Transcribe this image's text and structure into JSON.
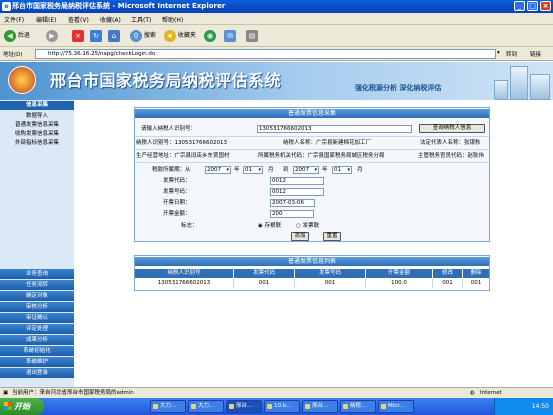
{
  "window": {
    "title": "邢台市国家税务局纳税评估系统 - Microsoft Internet Explorer",
    "min": "_",
    "max": "□",
    "close": "×"
  },
  "menu": [
    "文件(F)",
    "编辑(E)",
    "查看(V)",
    "收藏(A)",
    "工具(T)",
    "帮助(H)"
  ],
  "toolbar": {
    "back": "后退",
    "search": "搜索",
    "favorites": "收藏夹"
  },
  "address": {
    "label": "地址(D)",
    "url": "http://75.36.16.25/napg/checkLogin.do",
    "go": "转到",
    "links": "链接"
  },
  "banner": {
    "title": "邢台市国家税务局纳税评估系统",
    "slogan": "强化税源分析   深化纳税评估"
  },
  "sidebar": {
    "section": "信息采集",
    "items": [
      "数据导入",
      "普通发票信息采集",
      "收购发票信息采集",
      "外部指标信息采集"
    ],
    "bottom": [
      "业务查询",
      "任务流转",
      "确定对象",
      "审核分析",
      "审证确认",
      "评定处理",
      "成果分析",
      "系统初始化",
      "系统维护",
      "退出登录"
    ]
  },
  "form": {
    "title": "普通发票信息采集",
    "taxpayer_id_label": "请输入纳税人识别号：",
    "taxpayer_id_value": "130531766602013",
    "query_button": "查询纳税人信息",
    "row1": {
      "id": "纳税人识别号：130531766602013",
      "name": "纳税人名称：广宗县新建棉花加工厂",
      "rep": "法定代表人名称：张银秋"
    },
    "row2": {
      "addr": "生产经营地址：广宗县旧店乡东贾固村",
      "org": "所属税务机关代码：广宗县国家税务局城区税务分局",
      "officer": "主管税务官员代码：赵耿伟"
    },
    "period": {
      "label": "税款所属期：从",
      "y1": "2007",
      "year": "年",
      "m1": "01",
      "month": "月",
      "to": "到",
      "y2": "2007",
      "m2": "01"
    },
    "code_label": "发票代码：",
    "code_value": "0012",
    "num_label": "发票号码：",
    "num_value": "0012",
    "date_label": "开票日期：",
    "date_value": "2007-03-06",
    "amount_label": "开票金额：",
    "amount_value": "200",
    "flag_label": "标志：",
    "flag_opt1": "存根联",
    "flag_opt2": "发票联",
    "add_button": "添加",
    "reset_button": "重置"
  },
  "list": {
    "title": "普通发票信息列表",
    "headers": [
      "纳税人识别号",
      "发票代码",
      "发票号码",
      "开票金额",
      "修改",
      "删除"
    ],
    "row": [
      "130531766602013",
      "001",
      "001",
      "100.0",
      "001",
      "001"
    ]
  },
  "status": {
    "text": "当前用户：来自河北省邢台市国家税务局的admin",
    "zone": "Internet"
  },
  "taskbar": {
    "start": "开始",
    "tasks": [
      "大力...",
      "大力...",
      "邢台...",
      "10.b...",
      "邢台...",
      "纳税...",
      "Micr..."
    ],
    "clock": "14:50"
  }
}
